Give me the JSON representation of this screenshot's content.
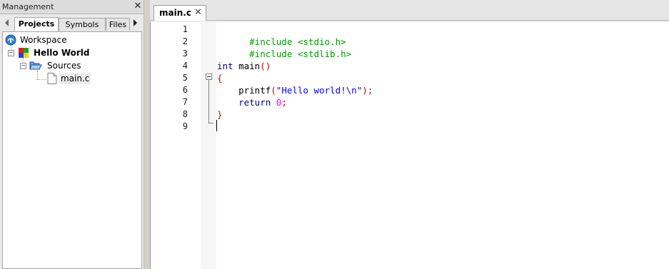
{
  "management": {
    "title": "Management",
    "tabs": [
      {
        "label": "Projects",
        "active": true
      },
      {
        "label": "Symbols",
        "active": false
      },
      {
        "label": "Files",
        "active": false
      }
    ],
    "tree": {
      "workspace": "Workspace",
      "project": "Hello World",
      "folder": "Sources",
      "file": "main.c"
    }
  },
  "editor": {
    "tab_label": "main.c",
    "line_numbers": [
      "1",
      "2",
      "3",
      "4",
      "5",
      "6",
      "7",
      "8",
      "9"
    ],
    "colors": {
      "preprocessor": "#00a000",
      "keyword": "#00008b",
      "brace": "#d00000",
      "string": "#0000ff",
      "number": "#ff00ff"
    },
    "code": {
      "l1": "#include <stdio.h>",
      "l2": "#include <stdlib.h>",
      "l4_kw": "int",
      "l4_name": " main",
      "l4_parens": "()",
      "l5": "{",
      "l6_fn": "    printf",
      "l6_open": "(",
      "l6_str": "\"Hello world!\\n\"",
      "l6_close": ");",
      "l7_kw": "    return",
      "l7_sp": " ",
      "l7_num": "0",
      "l7_end": ";",
      "l8": "}"
    }
  },
  "icons": {
    "workspace": "workspace-globe-icon",
    "project": "project-icon",
    "folder": "open-folder-icon",
    "file": "file-icon"
  }
}
